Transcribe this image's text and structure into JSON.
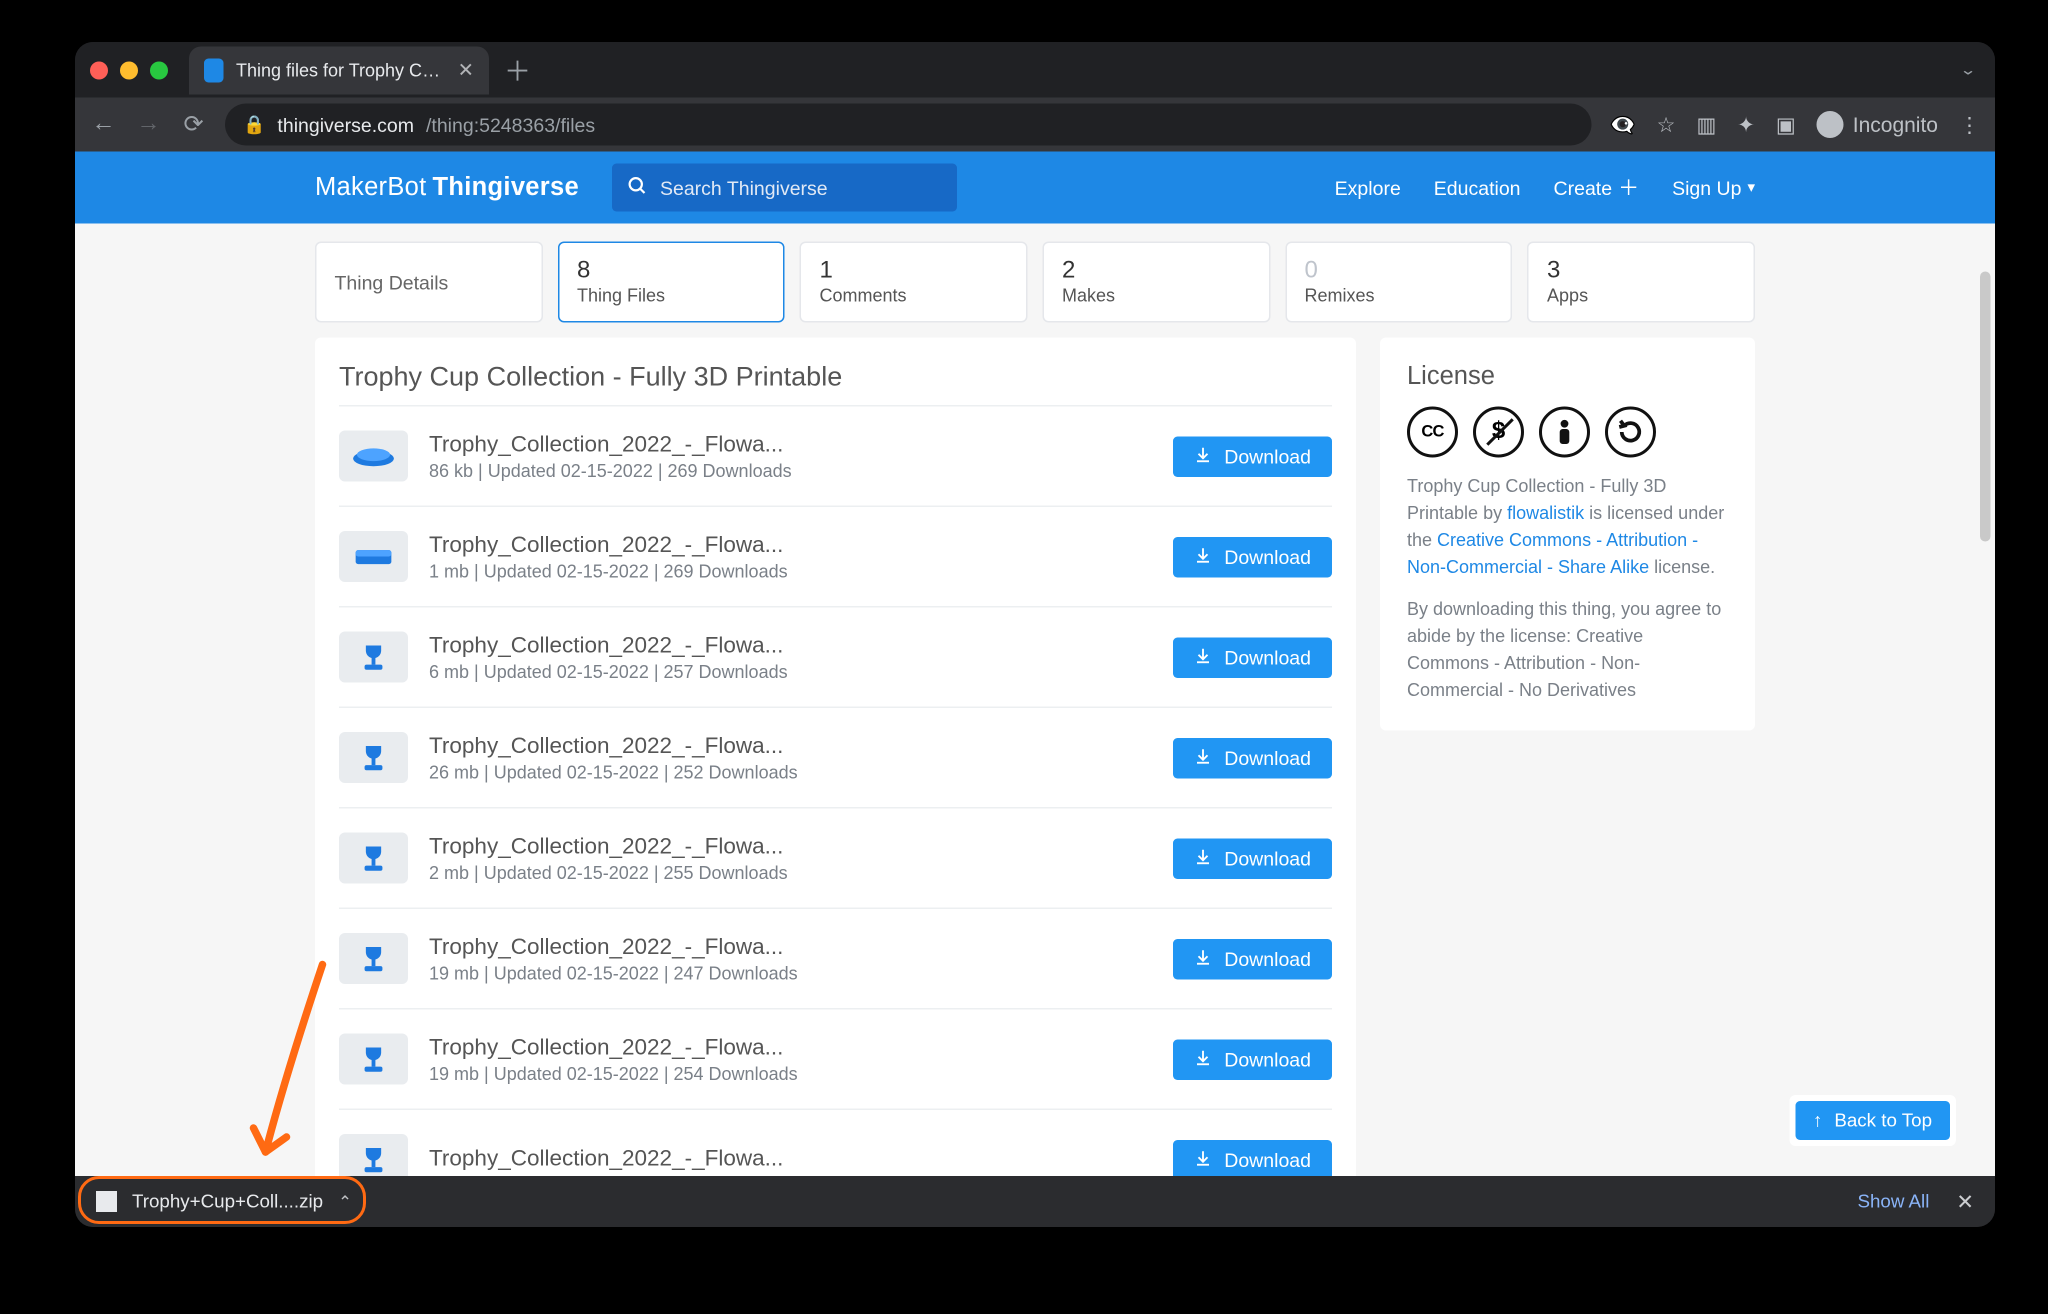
{
  "browser": {
    "tab_title": "Thing files for Trophy Cup Colle",
    "url_host": "thingiverse.com",
    "url_path": "/thing:5248363/files",
    "incognito_label": "Incognito"
  },
  "header": {
    "brand_maker": "MakerBot",
    "brand_site": "Thingiverse",
    "search_placeholder": "Search Thingiverse",
    "nav": {
      "explore": "Explore",
      "education": "Education",
      "create": "Create",
      "signup": "Sign Up"
    }
  },
  "tabs": [
    {
      "count": "",
      "label": "Thing Details"
    },
    {
      "count": "8",
      "label": "Thing Files"
    },
    {
      "count": "1",
      "label": "Comments"
    },
    {
      "count": "2",
      "label": "Makes"
    },
    {
      "count": "0",
      "label": "Remixes"
    },
    {
      "count": "3",
      "label": "Apps"
    }
  ],
  "panel_title": "Trophy Cup Collection - Fully 3D Printable",
  "download_label": "Download",
  "files": [
    {
      "name": "Trophy_Collection_2022_-_Flowa...",
      "meta": "86 kb | Updated 02-15-2022 | 269 Downloads",
      "thumb": "cap"
    },
    {
      "name": "Trophy_Collection_2022_-_Flowa...",
      "meta": "1 mb | Updated 02-15-2022 | 269 Downloads",
      "thumb": "base"
    },
    {
      "name": "Trophy_Collection_2022_-_Flowa...",
      "meta": "6 mb | Updated 02-15-2022 | 257 Downloads",
      "thumb": "cup"
    },
    {
      "name": "Trophy_Collection_2022_-_Flowa...",
      "meta": "26 mb | Updated 02-15-2022 | 252 Downloads",
      "thumb": "cup"
    },
    {
      "name": "Trophy_Collection_2022_-_Flowa...",
      "meta": "2 mb | Updated 02-15-2022 | 255 Downloads",
      "thumb": "cup"
    },
    {
      "name": "Trophy_Collection_2022_-_Flowa...",
      "meta": "19 mb | Updated 02-15-2022 | 247 Downloads",
      "thumb": "cup"
    },
    {
      "name": "Trophy_Collection_2022_-_Flowa...",
      "meta": "19 mb | Updated 02-15-2022 | 254 Downloads",
      "thumb": "cup"
    },
    {
      "name": "Trophy_Collection_2022_-_Flowa...",
      "meta": "",
      "thumb": "cup"
    }
  ],
  "license": {
    "heading": "License",
    "line1_a": "Trophy Cup Collection - Fully 3D Printable",
    "line1_b": "by ",
    "author": "flowalistik",
    "line1_c": " is licensed under the ",
    "link": "Creative Commons - Attribution - Non-Commercial - Share Alike",
    "line1_d": " license.",
    "line2": "By downloading this thing, you agree to abide by the license: Creative Commons - Attribution - Non-Commercial - No Derivatives"
  },
  "back_to_top": "Back to Top",
  "download_shelf": {
    "filename": "Trophy+Cup+Coll....zip",
    "show_all": "Show All"
  }
}
